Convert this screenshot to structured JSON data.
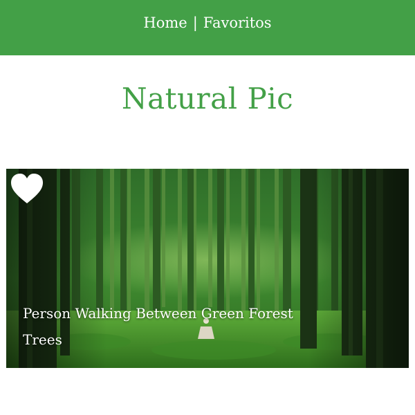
{
  "nav": {
    "home_label": "Home",
    "separator": "|",
    "favorites_label": "Favoritos"
  },
  "page": {
    "title": "Natural Pic"
  },
  "card": {
    "caption": "Person Walking Between Green Forest Trees",
    "favorite_icon": "heart-icon"
  },
  "colors": {
    "brand_green": "#43a047",
    "text_white": "#ffffff"
  }
}
